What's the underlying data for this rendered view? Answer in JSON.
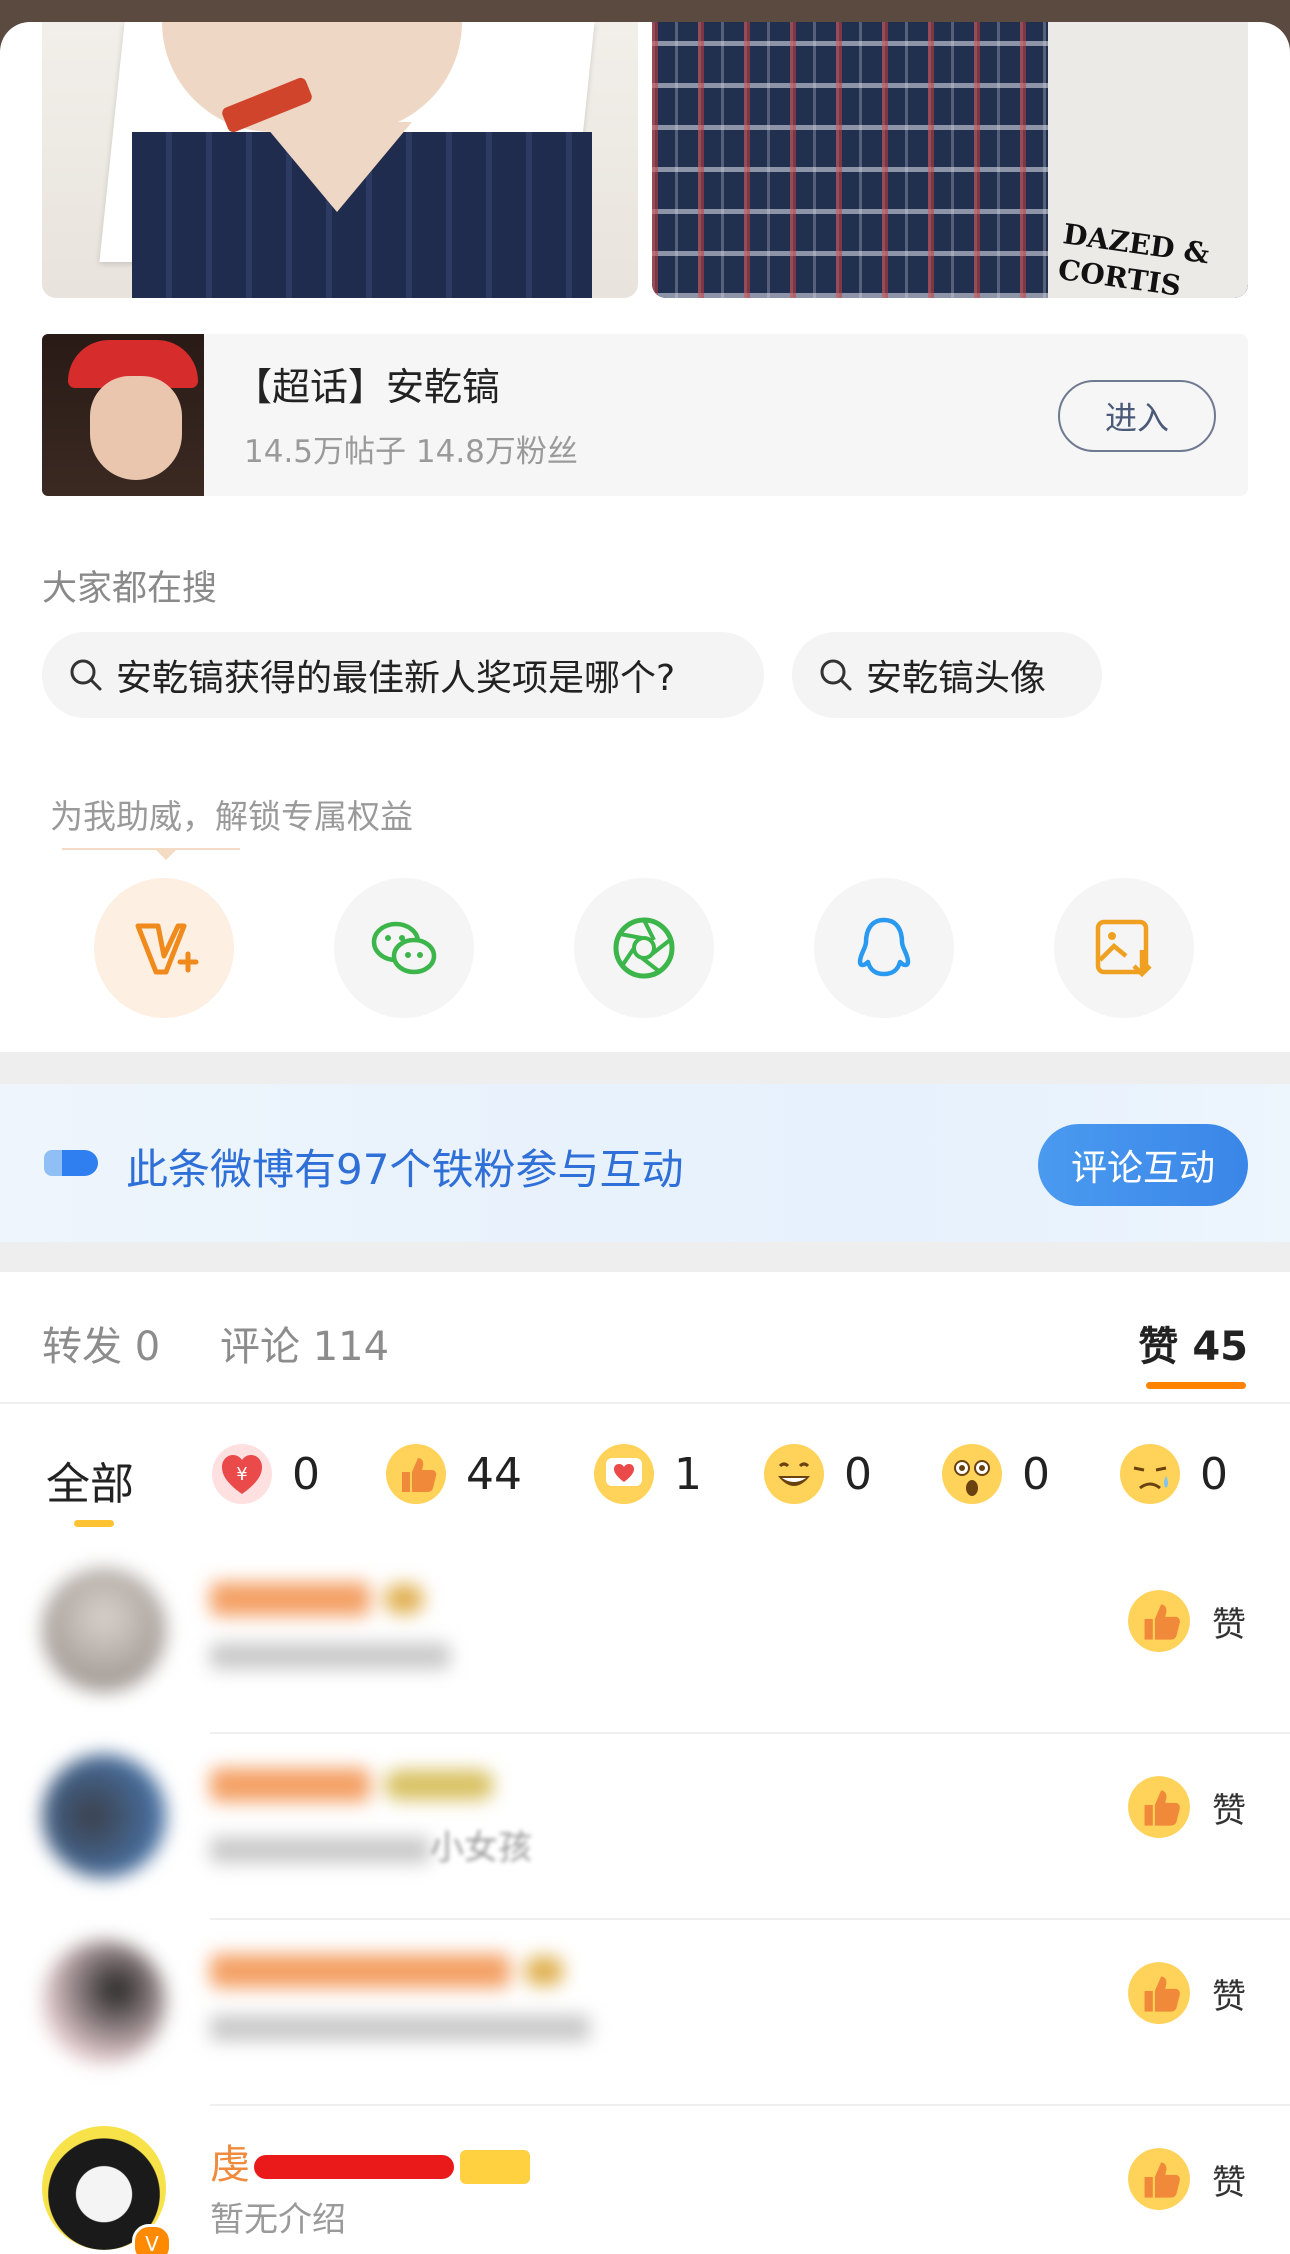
{
  "topic": {
    "title": "【超话】安乾镐",
    "stats": "14.5万帖子 14.8万粉丝",
    "enter_label": "进入"
  },
  "photo_right_logo": "DAZED & CORTIS",
  "search": {
    "label": "大家都在搜",
    "chips": [
      "安乾镐获得的最佳新人奖项是哪个?",
      "安乾镐头像"
    ]
  },
  "boost": {
    "label": "为我助威，解锁专属权益",
    "share_icons": [
      "vplus-icon",
      "wechat-icon",
      "moments-icon",
      "qq-icon",
      "save-image-icon"
    ]
  },
  "fan_banner": {
    "text": "此条微博有97个铁粉参与互动",
    "button": "评论互动"
  },
  "tabs": {
    "forward": "转发 0",
    "comment": "评论 114",
    "like": "赞 45"
  },
  "reactions": {
    "all_label": "全部",
    "items": [
      {
        "icon": "reward-heart-icon",
        "count": "0"
      },
      {
        "icon": "thumbs-up-icon",
        "count": "44"
      },
      {
        "icon": "heart-card-icon",
        "count": "1"
      },
      {
        "icon": "laugh-icon",
        "count": "0"
      },
      {
        "icon": "surprised-icon",
        "count": "0"
      },
      {
        "icon": "sad-icon",
        "count": "0"
      }
    ]
  },
  "likers": [
    {
      "name": "",
      "desc": "",
      "like_label": "赞"
    },
    {
      "name": "",
      "desc": "小女孩",
      "like_label": "赞"
    },
    {
      "name": "",
      "desc": "",
      "like_label": "赞"
    },
    {
      "name": "虔",
      "desc": "暂无介绍",
      "like_label": "赞"
    }
  ],
  "colors": {
    "accent_orange": "#ff8200",
    "link_blue": "#2f6fd8",
    "name_orange": "#f08a3c"
  }
}
